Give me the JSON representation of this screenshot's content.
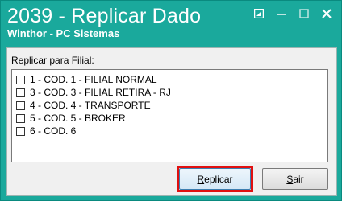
{
  "window": {
    "title": "2039 - Replicar Dado",
    "subtitle": "Winthor - PC Sistemas",
    "controls": [
      "restore-icon",
      "minimize-icon",
      "maximize-icon",
      "close-icon"
    ],
    "accent_color": "#1aa99c"
  },
  "form": {
    "label": "Replicar para Filial:",
    "items": [
      {
        "label": "1 - COD. 1 - FILIAL NORMAL",
        "checked": false
      },
      {
        "label": "3 - COD. 3 - FILIAL RETIRA - RJ",
        "checked": false
      },
      {
        "label": "4 - COD. 4 - TRANSPORTE",
        "checked": false
      },
      {
        "label": "5 - COD. 5 - BROKER",
        "checked": false
      },
      {
        "label": "6 - COD. 6",
        "checked": false
      }
    ]
  },
  "buttons": {
    "replicar_first": "R",
    "replicar_rest": "eplicar",
    "sair_first": "S",
    "sair_rest": "air",
    "highlight_color": "#e01010"
  }
}
